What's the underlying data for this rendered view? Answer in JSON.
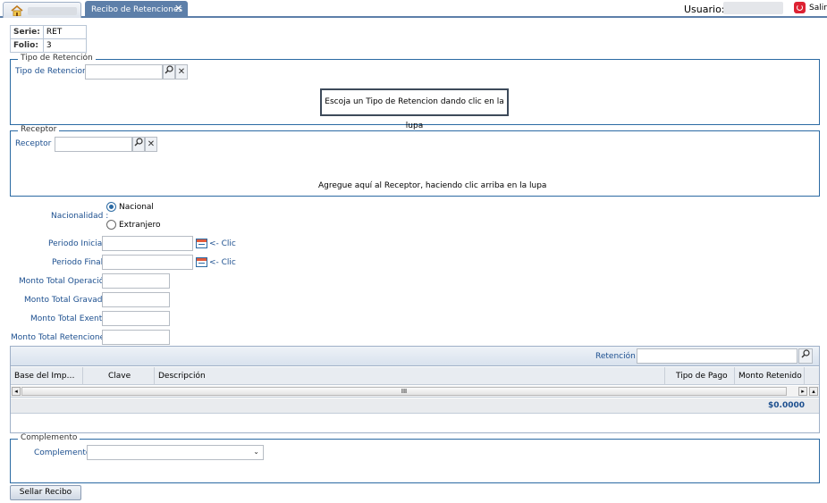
{
  "tabs": {
    "active_label": "Recibo de Retenciones",
    "close_glyph": "✕"
  },
  "header": {
    "usuario_label": "Usuario:",
    "salir_label": "Salir"
  },
  "doc": {
    "serie_label": "Serie:",
    "serie_value": "RET",
    "folio_label": "Folio:",
    "folio_value": "3"
  },
  "tipo_retencion": {
    "legend": "Tipo de Retención",
    "field_label": "Tipo de Retencion :",
    "value": "",
    "message": "Escoja un Tipo de Retencion dando clic en la lupa"
  },
  "receptor": {
    "legend": "Receptor",
    "field_label": "Receptor :",
    "value": "",
    "message": "Agregue aquí al Receptor, haciendo clic arriba en la lupa"
  },
  "nacionalidad": {
    "label": "Nacionalidad :",
    "options": [
      "Nacional",
      "Extranjero"
    ],
    "selected": "Nacional"
  },
  "fields": {
    "periodo_inicial_label": "Periodo Inicial :",
    "periodo_final_label": "Periodo Final :",
    "clic_hint": "<- Clic",
    "monto_operacion_label": "Monto Total Operación :",
    "monto_gravado_label": "Monto Total Gravado :",
    "monto_exento_label": "Monto Total Exento :",
    "monto_retenciones_label": "Monto Total Retenciones :"
  },
  "grid": {
    "search_label": "Retención :",
    "columns": [
      "Base del Imp…",
      "Clave",
      "Descripción",
      "Tipo de Pago",
      "Monto Retenido"
    ],
    "scroll_grip": "III",
    "total": "$0.0000"
  },
  "complemento": {
    "legend": "Complemento",
    "field_label": "Complemento :",
    "value": ""
  },
  "actions": {
    "sellar_label": "Sellar Recibo"
  },
  "icons": {
    "search": "magnifier-icon",
    "clear": "clear-x-icon",
    "calendar": "calendar-icon",
    "home": "home-icon",
    "power": "power-icon"
  }
}
